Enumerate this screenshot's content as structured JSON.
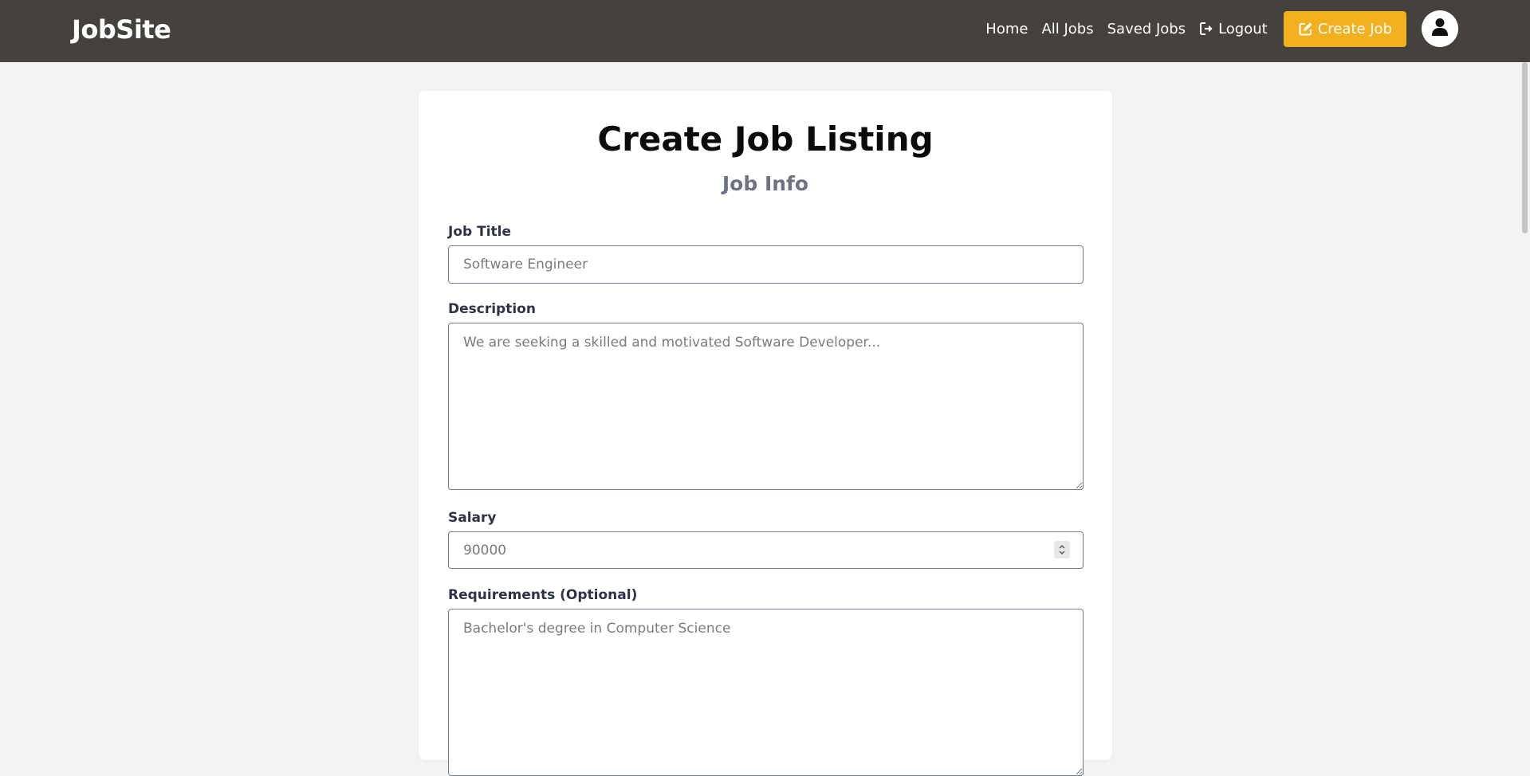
{
  "brand": "JobSite",
  "nav": {
    "home": "Home",
    "all_jobs": "All Jobs",
    "saved_jobs": "Saved Jobs",
    "logout": "Logout",
    "create_job": "Create Job"
  },
  "icons": {
    "logout": "sign-out-icon",
    "create_job": "edit-icon",
    "avatar": "user-icon"
  },
  "colors": {
    "navbar": "#45413c",
    "accent": "#f2b01e",
    "page_bg": "#f2f3f5"
  },
  "form": {
    "title": "Create Job Listing",
    "section": "Job Info",
    "job_title": {
      "label": "Job Title",
      "placeholder": "Software Engineer",
      "value": ""
    },
    "description": {
      "label": "Description",
      "placeholder": "We are seeking a skilled and motivated Software Developer...",
      "value": ""
    },
    "salary": {
      "label": "Salary",
      "placeholder": "90000",
      "value": ""
    },
    "requirements": {
      "label": "Requirements (Optional)",
      "placeholder": "Bachelor's degree in Computer Science",
      "value": ""
    }
  }
}
